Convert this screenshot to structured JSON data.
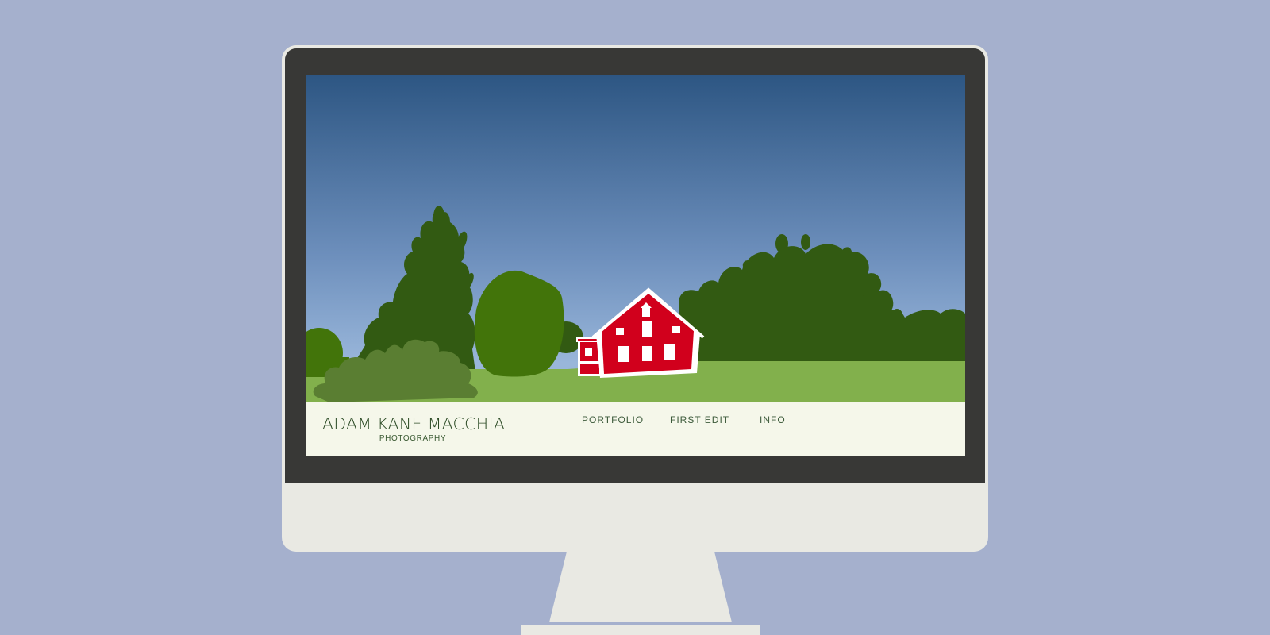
{
  "site": {
    "brand_name": "ADAM KANE MACCHIA",
    "brand_subtitle": "PHOTOGRAPHY"
  },
  "nav": {
    "items": [
      {
        "label": "PORTFOLIO"
      },
      {
        "label": "FIRST EDIT"
      },
      {
        "label": "INFO"
      }
    ]
  },
  "colors": {
    "page_background": "#a5b0cd",
    "monitor_body": "#e9e9e3",
    "bezel": "#383836",
    "sky_top": "#2d5683",
    "sky_bottom": "#99b6da",
    "grass": "#82b04c",
    "trees_dark": "#325a12",
    "tree_round": "#42740a",
    "bush": "#5a7e32",
    "barn": "#d1001c",
    "header_background": "#f5f7ea",
    "header_text": "#2b4a24"
  }
}
